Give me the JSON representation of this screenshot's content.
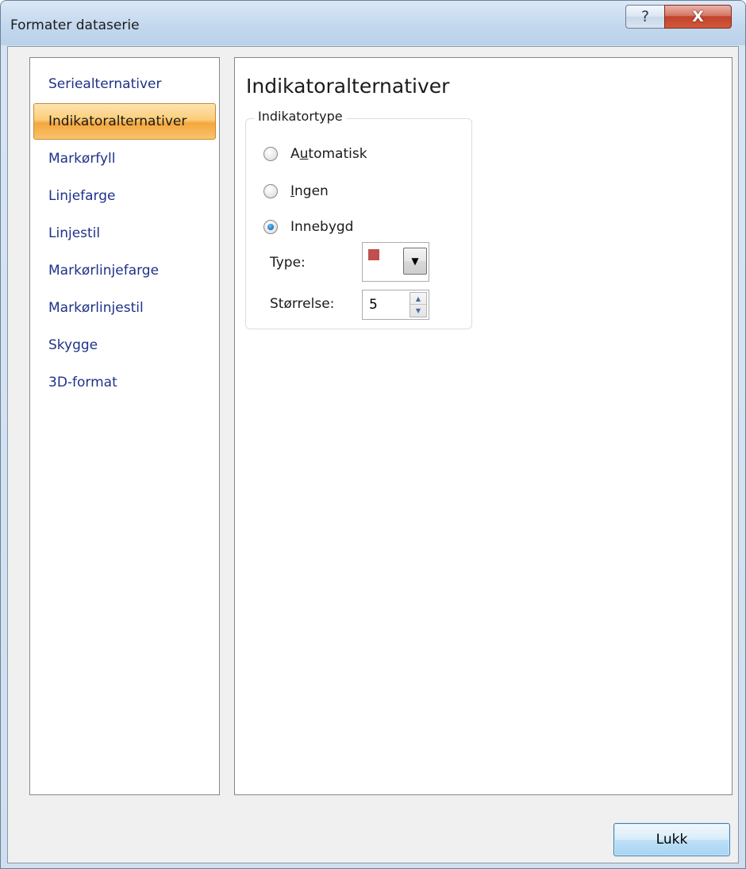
{
  "window": {
    "title": "Formater dataserie",
    "help_glyph": "?",
    "close_glyph": "X"
  },
  "sidebar": {
    "items": [
      {
        "label": "Seriealternativer",
        "selected": false
      },
      {
        "label": "Indikatoralternativer",
        "selected": true
      },
      {
        "label": "Markørfyll",
        "selected": false
      },
      {
        "label": "Linjefarge",
        "selected": false
      },
      {
        "label": "Linjestil",
        "selected": false
      },
      {
        "label": "Markørlinjefarge",
        "selected": false
      },
      {
        "label": "Markørlinjestil",
        "selected": false
      },
      {
        "label": "Skygge",
        "selected": false
      },
      {
        "label": "3D-format",
        "selected": false
      }
    ]
  },
  "main": {
    "heading": "Indikatoralternativer",
    "group": {
      "legend": "Indikatortype",
      "options": [
        {
          "pre": "A",
          "accel": "u",
          "post": "tomatisk",
          "checked": false
        },
        {
          "pre": "",
          "accel": "I",
          "post": "ngen",
          "checked": false
        },
        {
          "pre": "Innebygd",
          "accel": "",
          "post": "",
          "checked": true
        }
      ],
      "type_label": "Type:",
      "size_label": "Størrelse:",
      "size_value": "5",
      "marker_color": "#c0504d",
      "dropdown_glyph": "▼",
      "spin_up_glyph": "▲",
      "spin_down_glyph": "▼"
    }
  },
  "footer": {
    "close_label": "Lukk"
  }
}
